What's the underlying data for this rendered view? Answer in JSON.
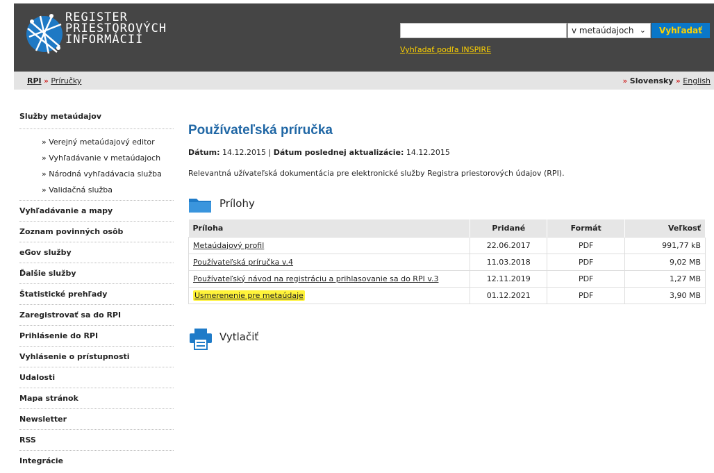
{
  "header": {
    "logo_lines": [
      "REGISTER",
      "PRIESTOROVÝCH",
      "INFORMÁCIÍ"
    ],
    "search": {
      "placeholder": "",
      "scope_selected": "v metaúdajoch",
      "button_label": "Vyhľadať",
      "inspire_link": "Vyhľadať podľa INSPIRE"
    }
  },
  "breadcrumb": {
    "home": "RPI",
    "sep": "»",
    "current": "Príručky"
  },
  "language": {
    "sep": "»",
    "current": "Slovensky",
    "other": "English"
  },
  "sidebar": {
    "first": "Služby metaúdajov",
    "subitems": [
      "» Verejný metaúdajový editor",
      "» Vyhľadávanie v metaúdajoch",
      "» Národná vyhľadávacia služba",
      "» Validačná služba"
    ],
    "items": [
      "Vyhľadávanie a mapy",
      "Zoznam povinných osôb",
      "eGov služby",
      "Ďalšie služby",
      "Štatistické prehľady",
      "Zaregistrovať sa do RPI",
      "Prihlásenie do RPI",
      "Vyhlásenie o prístupnosti",
      "Udalosti",
      "Mapa stránok",
      "Newsletter",
      "RSS",
      "Integrácie"
    ]
  },
  "main": {
    "title": "Používateľská príručka",
    "date_label": "Dátum:",
    "date_value": "14.12.2015",
    "date_sep": "|",
    "updated_label": "Dátum poslednej aktualizácie:",
    "updated_value": "14.12.2015",
    "description": "Relevantná užívateľská dokumentácia pre elektronické služby Registra priestorových údajov (RPI).",
    "attachments_title": "Prílohy",
    "columns": [
      "Príloha",
      "Pridané",
      "Formát",
      "Veľkosť"
    ],
    "rows": [
      {
        "name": "Metaúdajový profil",
        "added": "22.06.2017",
        "format": "PDF",
        "size": "991,77 kB"
      },
      {
        "name": "Používateľská príručka v.4",
        "added": "11.03.2018",
        "format": "PDF",
        "size": "9,02 MB"
      },
      {
        "name": "Používateľský návod na registráciu a prihlasovanie sa do RPI v.3",
        "added": "12.11.2019",
        "format": "PDF",
        "size": "1,27 MB"
      },
      {
        "name": "Usmerenenie pre metaúdaje",
        "added": "01.12.2021",
        "format": "PDF",
        "size": "3,90 MB",
        "highlighted": true
      }
    ],
    "print_label": "Vytlačiť"
  },
  "colors": {
    "header_bg": "#454545",
    "accent_blue": "#0a77c9",
    "title_blue": "#2067a5",
    "link_yellow": "#ffd200",
    "highlight": "#fff33a"
  }
}
